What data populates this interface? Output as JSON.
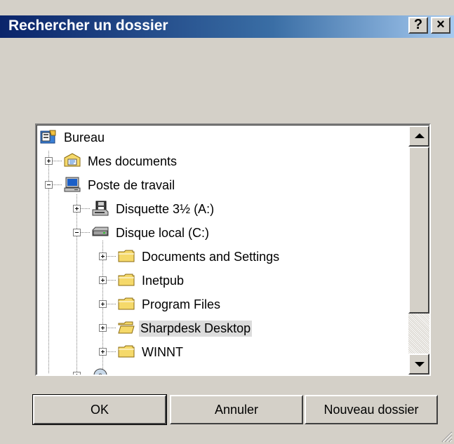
{
  "dialog": {
    "title": "Rechercher un dossier",
    "help_glyph": "?",
    "close_glyph": "×"
  },
  "tree": {
    "items": [
      {
        "label": "Bureau",
        "icon": "desktop-icon"
      },
      {
        "label": "Mes documents",
        "icon": "my-documents-icon",
        "expander": "+"
      },
      {
        "label": "Poste de travail",
        "icon": "my-computer-icon",
        "expander": "-"
      },
      {
        "label": "Disquette 3½ (A:)",
        "icon": "floppy-drive-icon",
        "expander": "+"
      },
      {
        "label": "Disque local (C:)",
        "icon": "hard-drive-icon",
        "expander": "-"
      },
      {
        "label": "Documents and Settings",
        "icon": "folder-icon",
        "expander": "+"
      },
      {
        "label": "Inetpub",
        "icon": "folder-icon",
        "expander": "+"
      },
      {
        "label": "Program Files",
        "icon": "folder-icon",
        "expander": "+"
      },
      {
        "label": "Sharpdesk Desktop",
        "icon": "folder-open-icon",
        "expander": "+",
        "selected": true
      },
      {
        "label": "WINNT",
        "icon": "folder-icon",
        "expander": "+"
      }
    ]
  },
  "buttons": {
    "ok": "OK",
    "cancel": "Annuler",
    "new_folder": "Nouveau dossier"
  },
  "colors": {
    "title_gradient_start": "#0a246a",
    "title_gradient_end": "#a6caf0",
    "face": "#d4d0c8",
    "folder_yellow": "#f5d96a"
  }
}
